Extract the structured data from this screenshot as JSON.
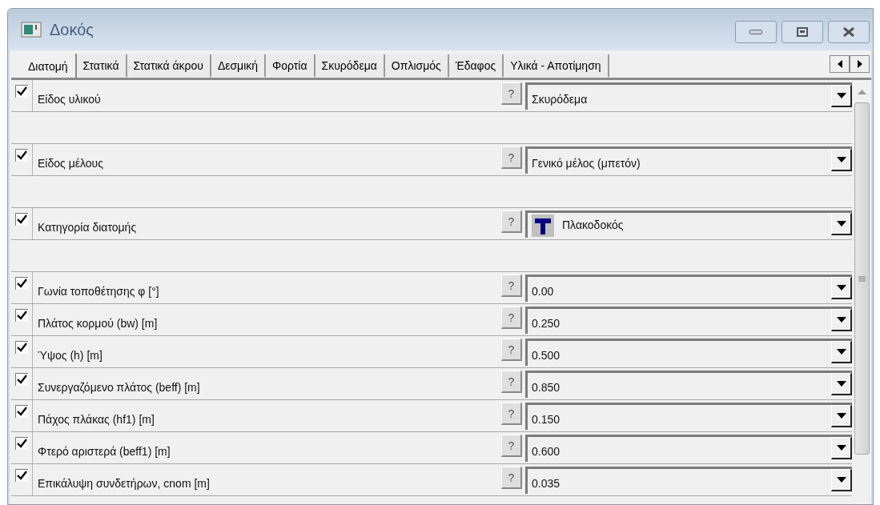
{
  "window": {
    "title": "Δοκός"
  },
  "tabs": [
    {
      "label": "Διατομή",
      "selected": true
    },
    {
      "label": "Στατικά",
      "selected": false
    },
    {
      "label": "Στατικά άκρου",
      "selected": false
    },
    {
      "label": "Δεσμική",
      "selected": false
    },
    {
      "label": "Φορτία",
      "selected": false
    },
    {
      "label": "Σκυρόδεμα",
      "selected": false
    },
    {
      "label": "Οπλισμός",
      "selected": false
    },
    {
      "label": "Έδαφος",
      "selected": false
    },
    {
      "label": "Υλικά - Αποτίμηση",
      "selected": false
    }
  ],
  "rows": [
    {
      "kind": "field",
      "checked": true,
      "label": "Είδος υλικού",
      "help": "?",
      "value": "Σκυρόδεμα"
    },
    {
      "kind": "gap"
    },
    {
      "kind": "field",
      "checked": true,
      "label": "Είδος μέλους",
      "help": "?",
      "value": "Γενικό μέλος (μπετόν)"
    },
    {
      "kind": "gap"
    },
    {
      "kind": "icon-field",
      "checked": true,
      "label": "Κατηγορία διατομής",
      "help": "?",
      "value": "Πλακοδοκός"
    },
    {
      "kind": "gap"
    },
    {
      "kind": "field",
      "checked": true,
      "label": "Γωνία τοποθέτησης φ [°]",
      "help": "?",
      "value": "0.00"
    },
    {
      "kind": "field",
      "checked": true,
      "label": "Πλάτος κορμού (bw) [m]",
      "help": "?",
      "value": "0.250"
    },
    {
      "kind": "field",
      "checked": true,
      "label": "Ύψος (h) [m]",
      "help": "?",
      "value": "0.500"
    },
    {
      "kind": "field",
      "checked": true,
      "label": "Συνεργαζόμενο πλάτος (beff) [m]",
      "help": "?",
      "value": "0.850"
    },
    {
      "kind": "field",
      "checked": true,
      "label": "Πάχος πλάκας (hf1) [m]",
      "help": "?",
      "value": "0.150"
    },
    {
      "kind": "field",
      "checked": true,
      "label": "Φτερό αριστερά (beff1) [m]",
      "help": "?",
      "value": "0.600"
    },
    {
      "kind": "field",
      "checked": true,
      "label": "Επικάλυψη συνδετήρων, cnom [m]",
      "help": "?",
      "value": "0.035"
    }
  ]
}
